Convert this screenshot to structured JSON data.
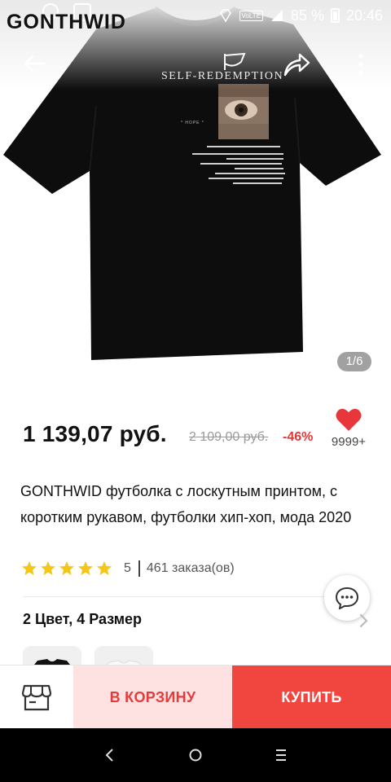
{
  "status_bar": {
    "brand_watermark": "GONTHWID",
    "network_label": "VoLTE",
    "battery": "85 %",
    "time": "20:46"
  },
  "hero": {
    "print_title": "SELF-REDEMPTION",
    "print_tag": "* HOPE *",
    "image_counter": "1/6"
  },
  "product": {
    "price": "1 139,07 руб.",
    "old_price": "2 109,00 руб.",
    "discount": "-46%",
    "favorites_count": "9999+",
    "title": "GONTHWID футболка с лоскутным принтом, с коротким рукавом, футболки хип-хоп, мода 2020",
    "rating": "5",
    "stars_filled": 5,
    "orders": "461 заказа(ов)",
    "variants": "2 Цвет, 4 Размер"
  },
  "actions": {
    "add_to_cart": "В КОРЗИНУ",
    "buy": "КУПИТЬ"
  },
  "colors": {
    "accent_red": "#f0463f",
    "cart_bg": "#fde2e1",
    "heart_red": "#e8373a",
    "star_gold": "#f5c518"
  },
  "icons": [
    "back-arrow-icon",
    "share-icon",
    "more-vertical-icon",
    "heart-icon",
    "star-icon",
    "chat-icon",
    "chevron-right-icon",
    "store-icon",
    "nav-back-icon",
    "nav-home-icon",
    "nav-recent-icon"
  ]
}
